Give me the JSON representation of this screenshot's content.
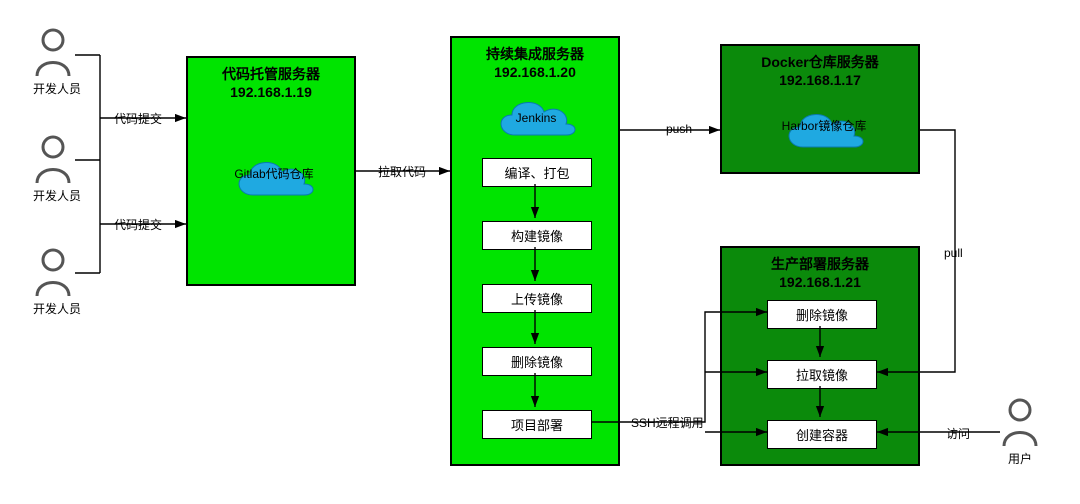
{
  "developers": {
    "label": "开发人员"
  },
  "user": {
    "label": "用户"
  },
  "edges": {
    "commit": "代码提交",
    "pull_code": "拉取代码",
    "push": "push",
    "pull": "pull",
    "ssh": "SSH远程调用",
    "visit": "访问"
  },
  "code_server": {
    "title": "代码托管服务器",
    "ip": "192.168.1.19",
    "cloud": "Gitlab代码仓库"
  },
  "ci_server": {
    "title": "持续集成服务器",
    "ip": "192.168.1.20",
    "cloud": "Jenkins",
    "steps": [
      "编译、打包",
      "构建镜像",
      "上传镜像",
      "删除镜像",
      "项目部署"
    ]
  },
  "docker_server": {
    "title": "Docker仓库服务器",
    "ip": "192.168.1.17",
    "cloud": "Harbor镜像仓库"
  },
  "prod_server": {
    "title": "生产部署服务器",
    "ip": "192.168.1.21",
    "steps": [
      "删除镜像",
      "拉取镜像",
      "创建容器"
    ]
  }
}
